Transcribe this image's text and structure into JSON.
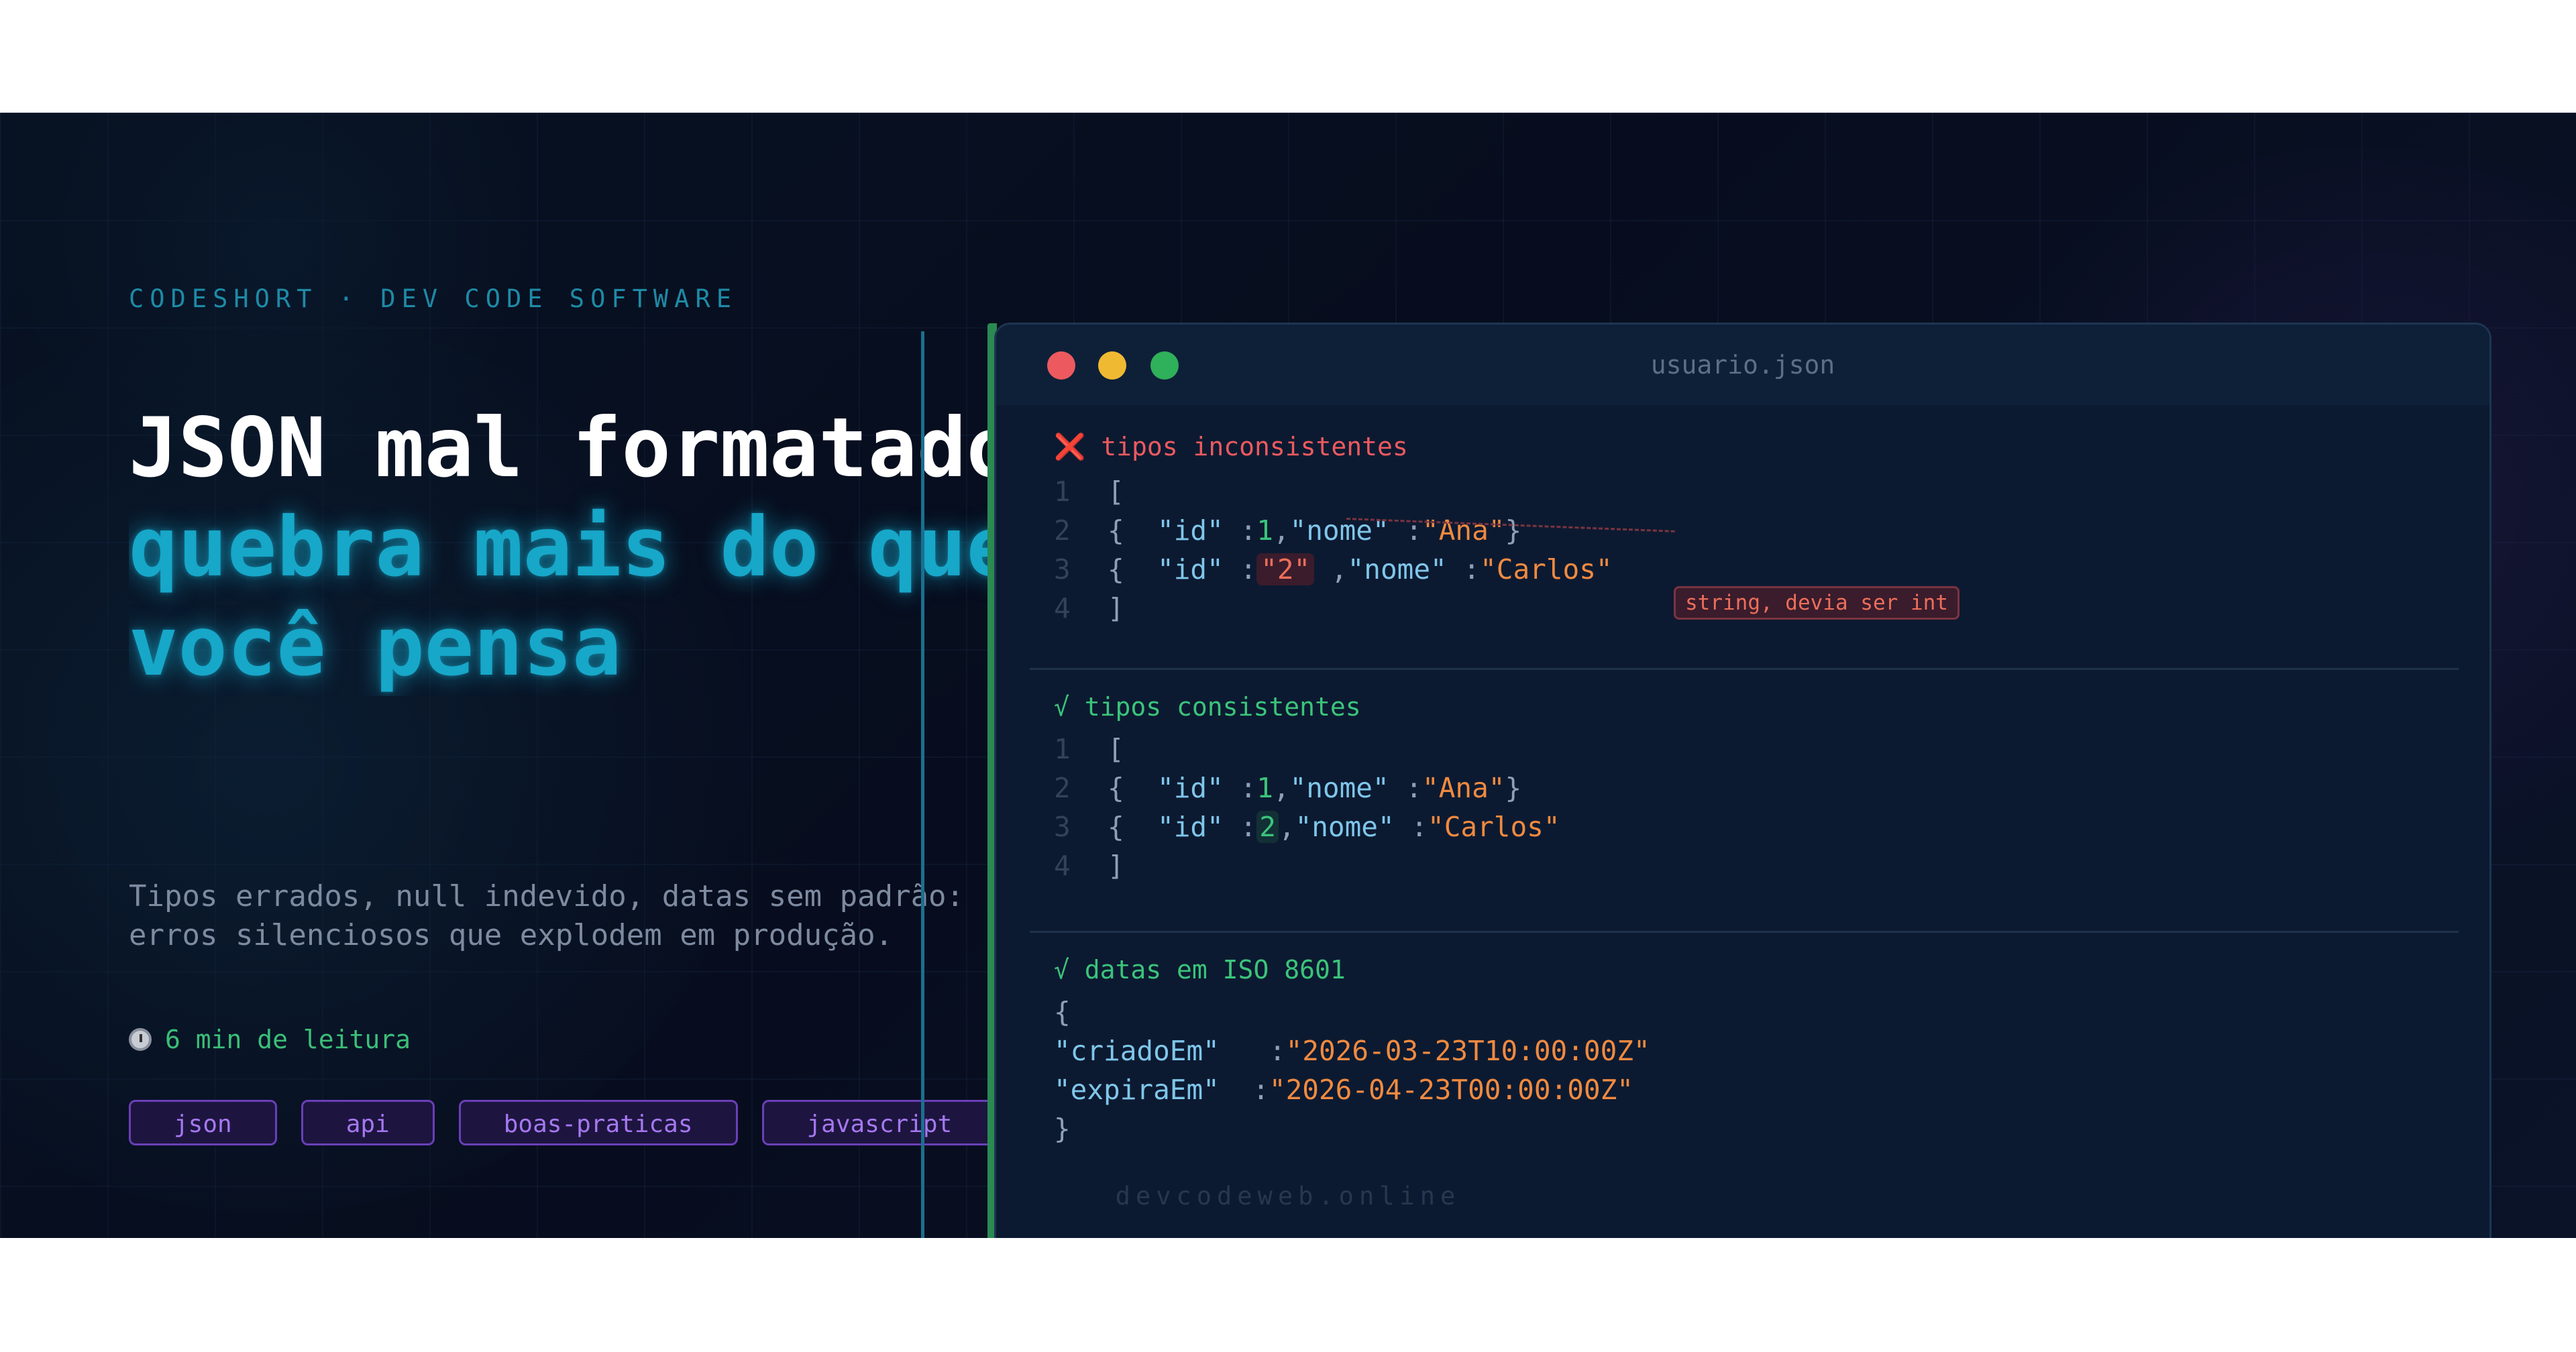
{
  "brand": {
    "kicker": "CODESHORT · DEV CODE SOFTWARE"
  },
  "headline": {
    "line1": "JSON mal formatado",
    "line2": "quebra mais do que",
    "line3": "você pensa"
  },
  "description": {
    "line1": "Tipos errados, null indevido, datas sem padrão:",
    "line2": "erros silenciosos que explodem em produção."
  },
  "reading": {
    "icon": "timer-icon",
    "text": "6 min de leitura"
  },
  "tags": [
    "json",
    "api",
    "boas-praticas",
    "javascript"
  ],
  "editor": {
    "filename": "usuario.json",
    "bad": {
      "icon": "cross-icon",
      "icon_glyph": "❌",
      "heading": "tipos inconsistentes",
      "numbers": [
        "1",
        "2",
        "3",
        "4"
      ],
      "open": "[",
      "close": "]",
      "row1": {
        "brace_open": "{",
        "id_key": "\"id\"",
        "sep": ":",
        "id_val": "1",
        "comma": ",",
        "name_key": "\"nome\"",
        "name_val": "\"Ana\"",
        "brace_close": "}"
      },
      "row2": {
        "brace_open": "{",
        "id_key": "\"id\"",
        "sep": ":",
        "id_val": "\"2\"",
        "comma": ",",
        "name_key": "\"nome\"",
        "name_val": "\"Carlos\""
      },
      "note": "string, devia ser int"
    },
    "good": {
      "check": "√",
      "heading": "tipos consistentes",
      "numbers": [
        "1",
        "2",
        "3",
        "4"
      ],
      "open": "[",
      "close": "]",
      "row1": {
        "brace_open": "{",
        "id_key": "\"id\"",
        "sep": ":",
        "id_val": "1",
        "comma": ",",
        "name_key": "\"nome\"",
        "name_val": "\"Ana\"",
        "brace_close": "}"
      },
      "row2": {
        "brace_open": "{",
        "id_key": "\"id\"",
        "sep": ":",
        "id_val": "2",
        "comma": ",",
        "name_key": "\"nome\"",
        "name_val": "\"Carlos\""
      }
    },
    "dates": {
      "check": "√",
      "heading": "datas em ISO 8601",
      "open": "{",
      "close": "}",
      "created_key": "\"criadoEm\"",
      "created_val": "\"2026-03-23T10:00:00Z\"",
      "expires_key": "\"expiraEm\"",
      "expires_val": "\"2026-04-23T00:00:00Z\"",
      "sep": ":"
    }
  },
  "footer": "devcodeweb.online"
}
